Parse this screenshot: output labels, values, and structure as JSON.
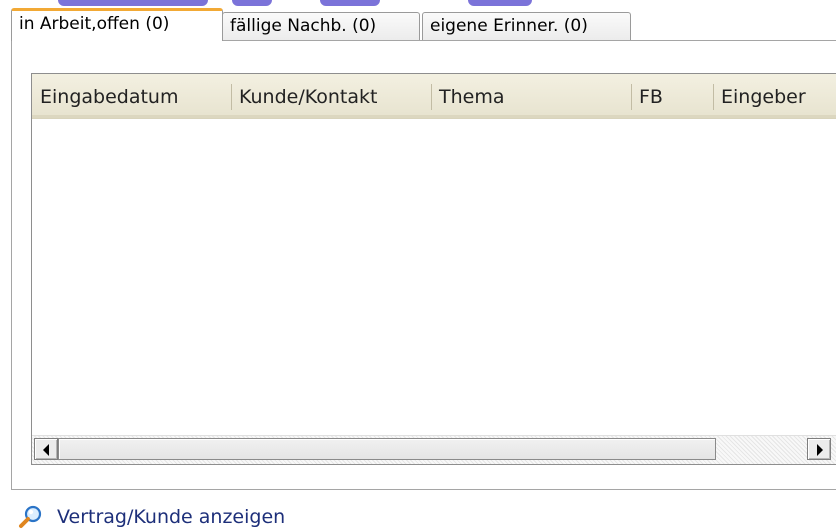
{
  "tabs": [
    {
      "label": "in Arbeit,offen (0)",
      "active": true
    },
    {
      "label": "fällige Nachb. (0)",
      "active": false
    },
    {
      "label": "eigene Erinner. (0)",
      "active": false
    }
  ],
  "grid": {
    "columns": [
      "Eingabedatum",
      "Kunde/Kontakt",
      "Thema",
      "FB",
      "Eingeber"
    ],
    "rows": []
  },
  "footer": {
    "show_link_label": "Vertrag/Kunde anzeigen",
    "icon": "magnifier-icon"
  },
  "colors": {
    "active_tab_accent": "#f2a935",
    "grid_header_bg": "#ece8d6",
    "link_text": "#1d2f7a"
  }
}
